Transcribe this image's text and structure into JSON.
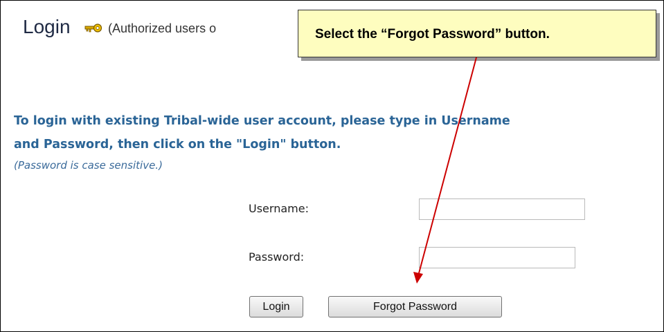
{
  "header": {
    "title": "Login",
    "note": "(Authorized users o"
  },
  "callout": {
    "text": "Select the “Forgot Password” button."
  },
  "instructions": {
    "line1": "To login with existing Tribal-wide user account, please type in Username",
    "line2": "and Password, then click on the \"Login\" button.",
    "case_note": "(Password is case sensitive.)"
  },
  "form": {
    "username_label": "Username:",
    "username_value": "",
    "password_label": "Password:",
    "password_value": "",
    "login_button": "Login",
    "forgot_button": "Forgot Password"
  },
  "icons": {
    "title_icon": "key-icon"
  },
  "colors": {
    "instruction_text": "#2a6496",
    "callout_background": "#fefdbf",
    "arrow": "#cc0000"
  }
}
